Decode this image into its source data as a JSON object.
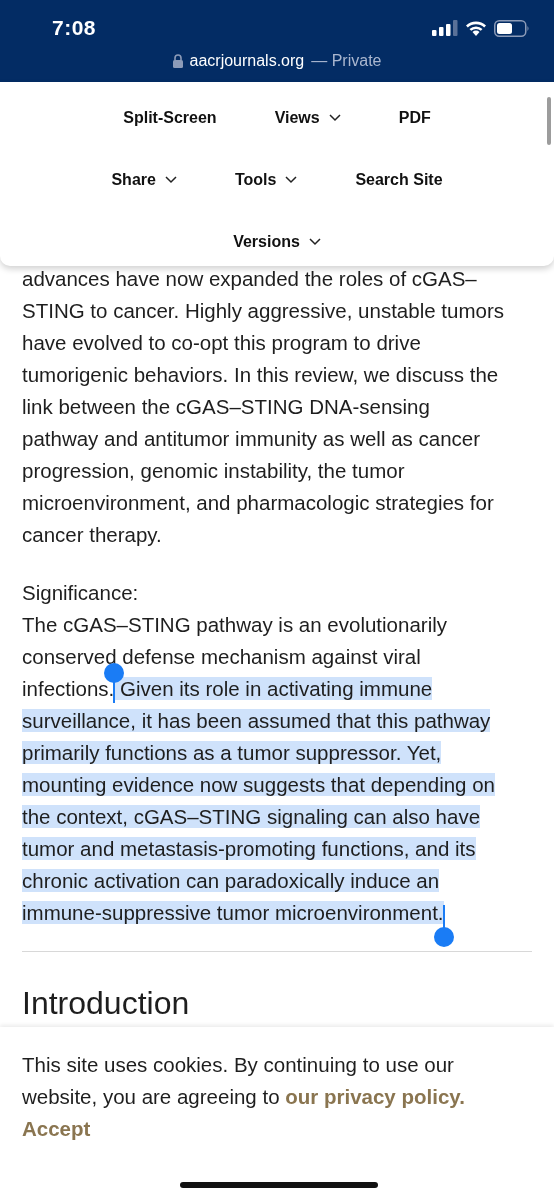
{
  "status_bar": {
    "time": "7:08"
  },
  "address_bar": {
    "domain": "aacrjournals.org",
    "mode": "— Private"
  },
  "menu": {
    "rows": [
      [
        {
          "label": "Split-Screen",
          "dropdown": false
        },
        {
          "label": "Views",
          "dropdown": true
        },
        {
          "label": "PDF",
          "dropdown": false
        }
      ],
      [
        {
          "label": "Share",
          "dropdown": true
        },
        {
          "label": "Tools",
          "dropdown": true
        },
        {
          "label": "Search Site",
          "dropdown": false
        }
      ],
      [
        {
          "label": "Versions",
          "dropdown": true
        }
      ]
    ]
  },
  "abstract": {
    "lines": [
      "advances have now expanded the roles of cGAS–",
      "STING to cancer. Highly aggressive, unstable tumors",
      "have evolved to co-opt this program to drive",
      "tumorigenic behaviors. In this review, we discuss the",
      "link between the cGAS–STING DNA-sensing",
      "pathway and antitumor immunity as well as cancer",
      "progression, genomic instability, the tumor",
      "microenvironment, and pharmacologic strategies for",
      "cancer therapy."
    ]
  },
  "significance": {
    "heading": "Significance:",
    "lines": [
      [
        {
          "text": "The cGAS–STING pathway is an evolutionarily",
          "selected": false
        }
      ],
      [
        {
          "text": "conserved defense mechanism against viral",
          "selected": false
        }
      ],
      [
        {
          "text": "infections.",
          "selected": false
        },
        {
          "text": " Given its role in activating immune",
          "selected": true
        }
      ],
      [
        {
          "text": "surveillance, it has been assumed that this pathway",
          "selected": true
        }
      ],
      [
        {
          "text": "primarily functions as a tumor suppressor. Yet,",
          "selected": true
        }
      ],
      [
        {
          "text": "mounting evidence now suggests that depending on",
          "selected": true
        }
      ],
      [
        {
          "text": "the context, cGAS–STING signaling can also have",
          "selected": true
        }
      ],
      [
        {
          "text": "tumor and metastasis-promoting functions, and its",
          "selected": true
        }
      ],
      [
        {
          "text": "chronic activation can paradoxically induce an",
          "selected": true
        }
      ],
      [
        {
          "text": "immune-suppressive tumor microenvironment.",
          "selected": true
        }
      ]
    ]
  },
  "introduction": {
    "heading": "Introduction"
  },
  "cookie_banner": {
    "text": "This site uses cookies. By continuing to use our website, you are agreeing to",
    "link": "our privacy policy.",
    "accept": "Accept"
  }
}
